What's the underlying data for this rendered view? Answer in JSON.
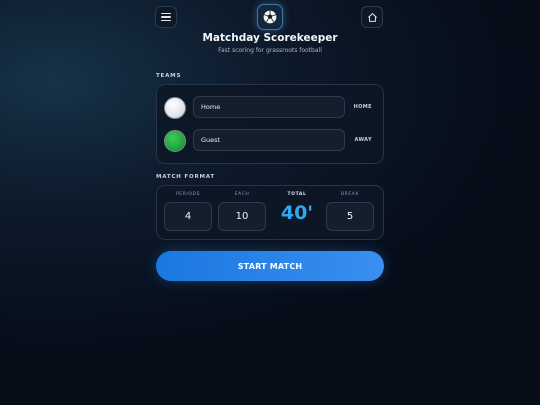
{
  "header": {
    "menu_icon": "hamburger-menu-icon",
    "logo_icon": "soccer-ball-icon",
    "home_icon": "home-icon",
    "title": "Matchday Scorekeeper",
    "subtitle": "Fast scoring for grassroots football"
  },
  "teams": {
    "section_label": "TEAMS",
    "home": {
      "name": "Home",
      "tag": "HOME",
      "color": "#ffffff"
    },
    "guest": {
      "name": "Guest",
      "tag": "AWAY",
      "color": "#1ea23a"
    }
  },
  "match_format": {
    "section_label": "MATCH FORMAT",
    "periods": {
      "label": "PERIODS",
      "value": "4"
    },
    "each": {
      "label": "EACH",
      "value": "10"
    },
    "total": {
      "label": "TOTAL",
      "value": "40'"
    },
    "break": {
      "label": "BREAK",
      "value": "5"
    }
  },
  "actions": {
    "start_label": "START MATCH"
  },
  "colors": {
    "accent": "#2fa8ef",
    "button": "#1a78e0",
    "background": "#0d1a2b"
  }
}
